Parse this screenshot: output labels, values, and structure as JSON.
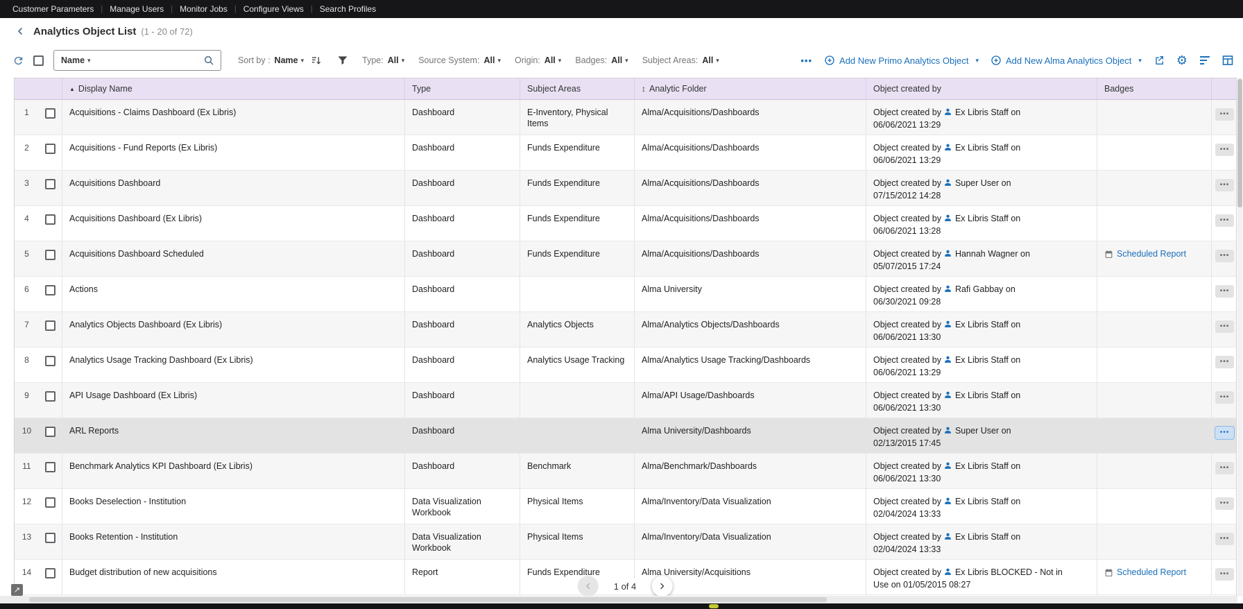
{
  "topbar": {
    "items": [
      "Customer Parameters",
      "Manage Users",
      "Monitor Jobs",
      "Configure Views",
      "Search Profiles"
    ]
  },
  "header": {
    "title": "Analytics Object List",
    "count": "(1 - 20 of 72)"
  },
  "toolbar": {
    "search_field": "Name",
    "sort_by_label": "Sort by :",
    "sort_value": "Name",
    "filters": [
      {
        "label": "Type:",
        "value": "All"
      },
      {
        "label": "Source System:",
        "value": "All"
      },
      {
        "label": "Origin:",
        "value": "All"
      },
      {
        "label": "Badges:",
        "value": "All"
      },
      {
        "label": "Subject Areas:",
        "value": "All"
      }
    ],
    "more_label": "•••",
    "add_primo": "Add New Primo Analytics Object",
    "add_alma": "Add New Alma Analytics Object"
  },
  "table": {
    "columns": [
      "Display Name",
      "Type",
      "Subject Areas",
      "Analytic Folder",
      "Object created by",
      "Badges"
    ],
    "created_prefix": "Object created by",
    "created_on_word": "on",
    "badge_label": "Scheduled Report",
    "rows": [
      {
        "num": "1",
        "name": "Acquisitions - Claims Dashboard (Ex Libris)",
        "type": "Dashboard",
        "subject": "E-Inventory, Physical Items",
        "folder": "Alma/Acquisitions/Dashboards",
        "creator": "Ex Libris Staff",
        "date": "06/06/2021 13:29",
        "badge": false,
        "selected": false
      },
      {
        "num": "2",
        "name": "Acquisitions - Fund Reports (Ex Libris)",
        "type": "Dashboard",
        "subject": "Funds Expenditure",
        "folder": "Alma/Acquisitions/Dashboards",
        "creator": "Ex Libris Staff",
        "date": "06/06/2021 13:29",
        "badge": false,
        "selected": false
      },
      {
        "num": "3",
        "name": "Acquisitions Dashboard",
        "type": "Dashboard",
        "subject": "Funds Expenditure",
        "folder": "Alma/Acquisitions/Dashboards",
        "creator": "Super User",
        "date": "07/15/2012 14:28",
        "badge": false,
        "selected": false
      },
      {
        "num": "4",
        "name": "Acquisitions Dashboard (Ex Libris)",
        "type": "Dashboard",
        "subject": "Funds Expenditure",
        "folder": "Alma/Acquisitions/Dashboards",
        "creator": "Ex Libris Staff",
        "date": "06/06/2021 13:28",
        "badge": false,
        "selected": false
      },
      {
        "num": "5",
        "name": "Acquisitions Dashboard Scheduled",
        "type": "Dashboard",
        "subject": "Funds Expenditure",
        "folder": "Alma/Acquisitions/Dashboards",
        "creator": "Hannah Wagner",
        "date": "05/07/2015 17:24",
        "badge": true,
        "selected": false
      },
      {
        "num": "6",
        "name": "Actions",
        "type": "Dashboard",
        "subject": "",
        "folder": "Alma University",
        "creator": "Rafi Gabbay",
        "date": "06/30/2021 09:28",
        "badge": false,
        "selected": false
      },
      {
        "num": "7",
        "name": "Analytics Objects Dashboard (Ex Libris)",
        "type": "Dashboard",
        "subject": "Analytics Objects",
        "folder": "Alma/Analytics Objects/Dashboards",
        "creator": "Ex Libris Staff",
        "date": "06/06/2021 13:30",
        "badge": false,
        "selected": false
      },
      {
        "num": "8",
        "name": "Analytics Usage Tracking Dashboard (Ex Libris)",
        "type": "Dashboard",
        "subject": "Analytics Usage Tracking",
        "folder": "Alma/Analytics Usage Tracking/Dashboards",
        "creator": "Ex Libris Staff",
        "date": "06/06/2021 13:29",
        "badge": false,
        "selected": false
      },
      {
        "num": "9",
        "name": "API Usage Dashboard (Ex Libris)",
        "type": "Dashboard",
        "subject": "",
        "folder": "Alma/API Usage/Dashboards",
        "creator": "Ex Libris Staff",
        "date": "06/06/2021 13:30",
        "badge": false,
        "selected": false
      },
      {
        "num": "10",
        "name": "ARL Reports",
        "type": "Dashboard",
        "subject": "",
        "folder": "Alma University/Dashboards",
        "creator": "Super User",
        "date": "02/13/2015 17:45",
        "badge": false,
        "selected": true
      },
      {
        "num": "11",
        "name": "Benchmark Analytics KPI Dashboard (Ex Libris)",
        "type": "Dashboard",
        "subject": "Benchmark",
        "folder": "Alma/Benchmark/Dashboards",
        "creator": "Ex Libris Staff",
        "date": "06/06/2021 13:30",
        "badge": false,
        "selected": false
      },
      {
        "num": "12",
        "name": "Books Deselection - Institution",
        "type": "Data Visualization Workbook",
        "subject": "Physical Items",
        "folder": "Alma/Inventory/Data Visualization",
        "creator": "Ex Libris Staff",
        "date": "02/04/2024 13:33",
        "badge": false,
        "selected": false
      },
      {
        "num": "13",
        "name": "Books Retention - Institution",
        "type": "Data Visualization Workbook",
        "subject": "Physical Items",
        "folder": "Alma/Inventory/Data Visualization",
        "creator": "Ex Libris Staff",
        "date": "02/04/2024 13:33",
        "badge": false,
        "selected": false
      },
      {
        "num": "14",
        "name": "Budget distribution of new acquisitions",
        "type": "Report",
        "subject": "Funds Expenditure",
        "folder": "Alma University/Acquisitions",
        "creator": "Ex Libris BLOCKED - Not in Use",
        "date": "01/05/2015 08:27",
        "badge": true,
        "selected": false
      }
    ]
  },
  "pagination": {
    "label": "1 of 4"
  },
  "icons": {
    "separator": "|",
    "caret_down": "▾",
    "sort_asc": "▲",
    "sort_updown": "↕",
    "gear": "⚙",
    "expand": "↗",
    "ellipsis": "•••"
  },
  "colors": {
    "accent": "#1a6fba",
    "table_header_bg": "#e9e1f3",
    "topbar_bg": "#161618"
  }
}
